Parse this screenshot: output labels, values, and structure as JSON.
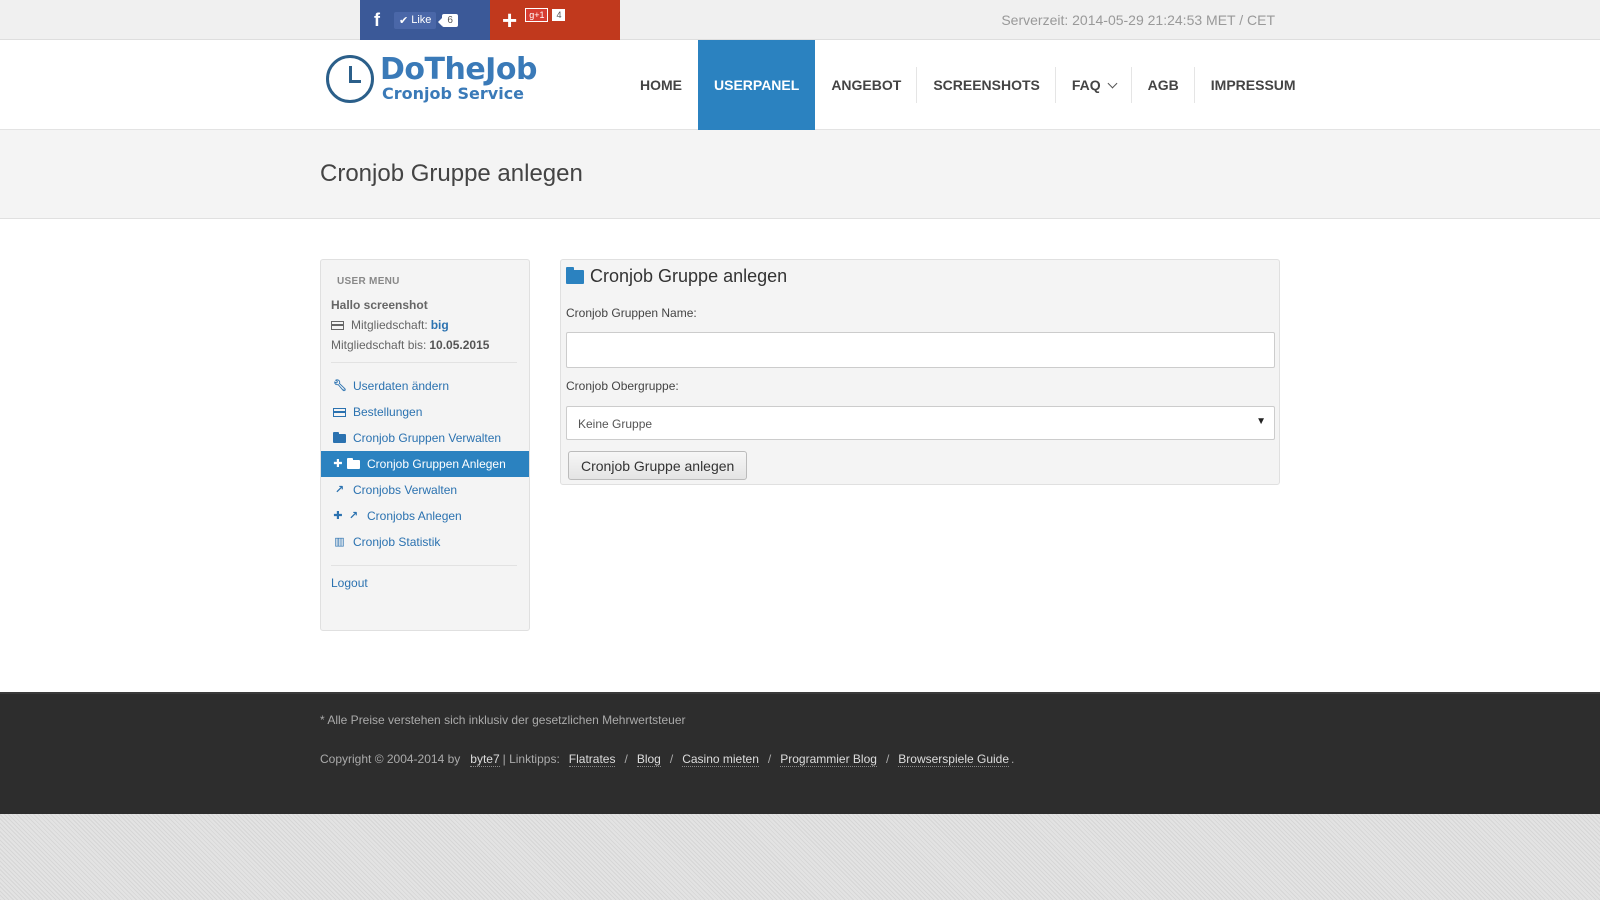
{
  "topbar": {
    "fb_letter": "f",
    "fb_like_label": "Like",
    "fb_count": "6",
    "gplus_plus": "+",
    "gplus_badge": "g+1",
    "gplus_count": "4",
    "server_time": "Serverzeit: 2014-05-29 21:24:53 MET / CET"
  },
  "header": {
    "logo_title": "DoTheJob",
    "logo_subtitle": "Cronjob Service",
    "nav": [
      {
        "label": "HOME"
      },
      {
        "label": "USERPANEL"
      },
      {
        "label": "ANGEBOT"
      },
      {
        "label": "SCREENSHOTS"
      },
      {
        "label": "FAQ"
      },
      {
        "label": "AGB"
      },
      {
        "label": "IMPRESSUM"
      }
    ],
    "active_nav": "USERPANEL"
  },
  "page": {
    "title": "Cronjob Gruppe anlegen"
  },
  "sidebar": {
    "heading": "USER MENU",
    "greeting": "Hallo screenshot",
    "membership_label": "Mitgliedschaft:",
    "membership_value": "big",
    "membership_until_label": "Mitgliedschaft bis:",
    "membership_until_value": "10.05.2015",
    "items": [
      {
        "label": "Userdaten ändern",
        "icon": "wrench-icon"
      },
      {
        "label": "Bestellungen",
        "icon": "credit-card-icon"
      },
      {
        "label": "Cronjob Gruppen Verwalten",
        "icon": "folder-icon"
      },
      {
        "label": "Cronjob Gruppen Anlegen",
        "icon": "folder-icon",
        "active": true
      },
      {
        "label": "Cronjobs Verwalten",
        "icon": "external-link-icon"
      },
      {
        "label": "Cronjobs Anlegen",
        "icon": "external-link-icon"
      },
      {
        "label": "Cronjob Statistik",
        "icon": "bar-chart-icon"
      }
    ],
    "logout": "Logout"
  },
  "form": {
    "title": "Cronjob Gruppe anlegen",
    "name_label": "Cronjob Gruppen Name:",
    "name_value": "",
    "parent_label": "Cronjob Obergruppe:",
    "parent_selected": "Keine Gruppe",
    "submit_label": "Cronjob Gruppe anlegen"
  },
  "footer": {
    "note": "* Alle Preise verstehen sich inklusiv der gesetzlichen Mehrwertsteuer",
    "copyright": "Copyright © 2004-2014 by",
    "byte7": "byte7",
    "linktipps": "| Linktipps:",
    "links": [
      "Flatrates",
      "Blog",
      "Casino mieten",
      "Programmier Blog",
      "Browserspiele Guide"
    ],
    "end": "."
  },
  "colors": {
    "accent": "#2b82c0",
    "link": "#2b72b0",
    "facebook": "#3b5998",
    "gplus": "#c1391d",
    "footer_bg": "#2d2d2d"
  }
}
